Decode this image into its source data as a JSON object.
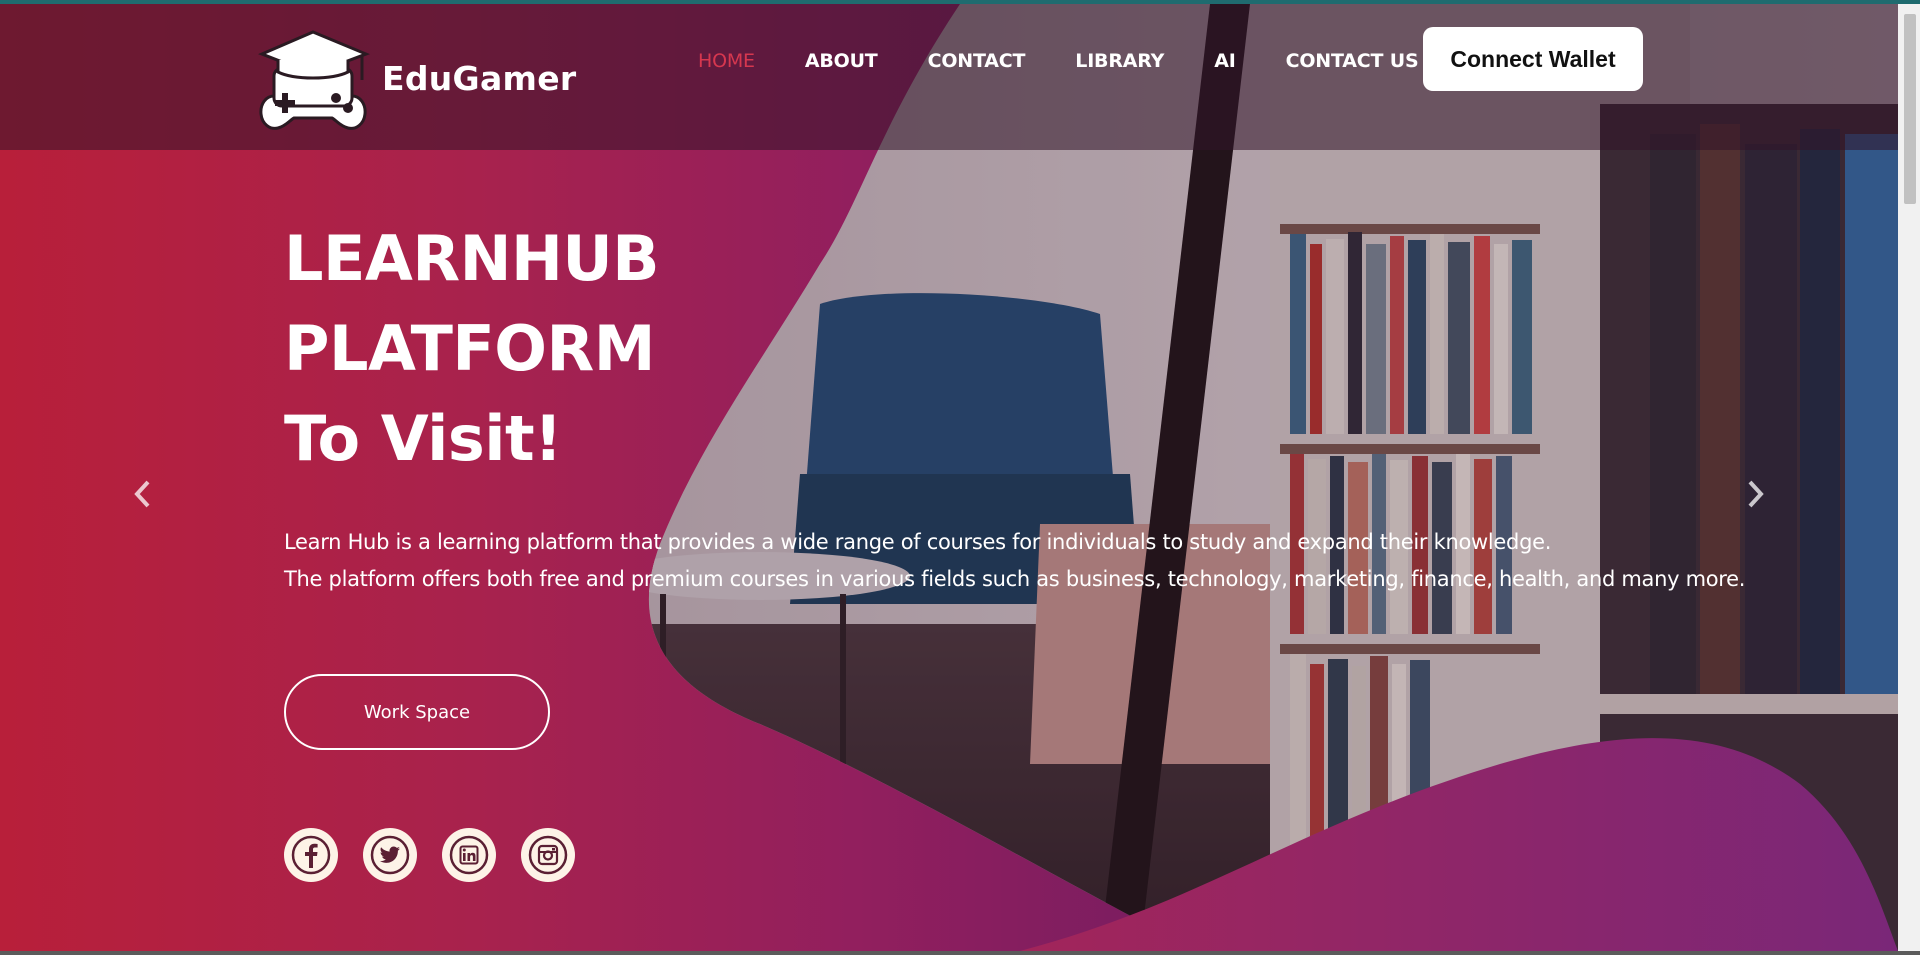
{
  "brand": {
    "name": "EduGamer"
  },
  "nav": {
    "items": [
      {
        "label": "HOME",
        "active": true
      },
      {
        "label": "ABOUT",
        "active": false
      },
      {
        "label": "CONTACT",
        "active": false
      },
      {
        "label": "LIBRARY",
        "active": false
      },
      {
        "label": "AI",
        "active": false
      },
      {
        "label": "CONTACT US",
        "active": false
      }
    ],
    "connect_label": "Connect Wallet"
  },
  "hero": {
    "line1": "LEARNHUB",
    "line2": "PLATFORM",
    "line3": "To Visit!",
    "desc1": "Learn Hub is a learning platform that provides a wide range of courses for individuals to study and expand their knowledge.",
    "desc2": "The platform offers both free and premium courses in various fields such as business, technology, marketing, finance, health, and many more.",
    "cta_label": "Work Space"
  },
  "socials": [
    {
      "icon": "facebook-icon"
    },
    {
      "icon": "twitter-icon"
    },
    {
      "icon": "linkedin-icon"
    },
    {
      "icon": "instagram-icon"
    }
  ],
  "colors": {
    "accent": "#d6374f",
    "hero_start": "#b81f3a",
    "hero_end": "#6a1c5e",
    "social_bg": "#fdf3e7"
  }
}
